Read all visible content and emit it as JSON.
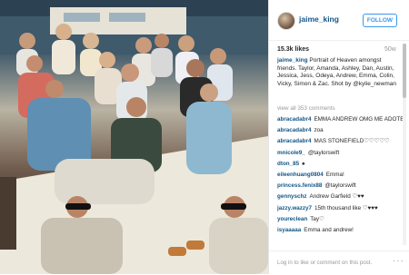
{
  "post": {
    "username": "jaime_king",
    "follow_label": "FOLLOW",
    "likes": "15.3k likes",
    "age": "50w",
    "caption_user": "jaime_king",
    "caption_text": "Portrait of Heaven amongst friends. Taylor, Amanda, Ashley, Dan, Austin, Jessica, Jess, Odeya, Andrew, Emma, Colin, Vicky, Simon & Zac. Shot by @kylie_newman",
    "view_all": "view all 353 comments",
    "login_text": "Log in to like or comment on this post.",
    "more_label": "···"
  },
  "comments": [
    {
      "user": "abracadabr4",
      "text": "EMMA ANDREW OMG ME ADOTEM I LOVE YOU"
    },
    {
      "user": "abracadabr4",
      "text": "zoa"
    },
    {
      "user": "abracadabr4",
      "text": "MAS STONEFIELD♡♡♡♡♡"
    },
    {
      "user": "mnicole9_",
      "text": "@taylorswift"
    },
    {
      "user": "dton_85",
      "text": "♠"
    },
    {
      "user": "eileenhuang0804",
      "text": "Emma!"
    },
    {
      "user": "princess.fenix88",
      "text": "@taylorswift"
    },
    {
      "user": "gennyschz",
      "text": "Andrew Garfield ♡♥♥"
    },
    {
      "user": "jazzy.wazzy7",
      "text": "15th thousand like ♡♥♥♥"
    },
    {
      "user": "youreclean",
      "text": "Tay♡"
    },
    {
      "user": "isyaaaaa",
      "text": "Emma and andrew!"
    }
  ],
  "colors": {
    "link": "#125688",
    "follow": "#3897f0"
  }
}
